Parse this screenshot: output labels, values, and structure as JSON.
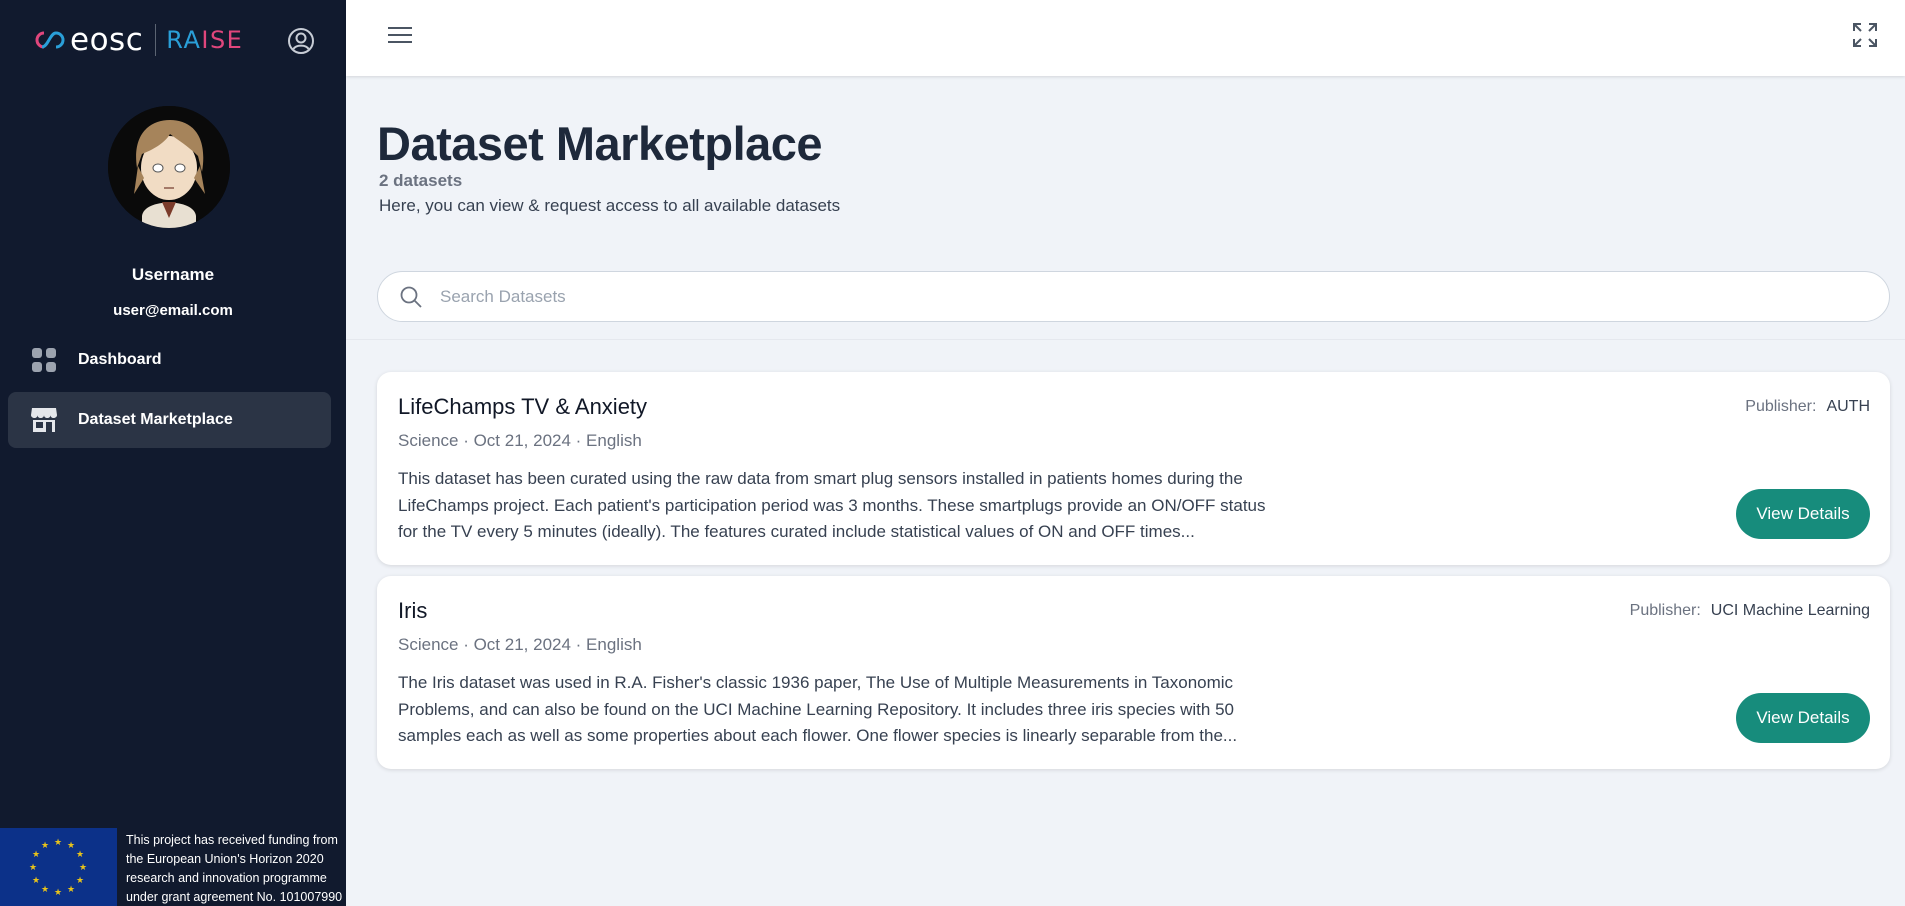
{
  "brand": {
    "name": "eosc",
    "product_a": "RA",
    "product_b": "ISE"
  },
  "user": {
    "username": "Username",
    "email": "user@email.com"
  },
  "sidebar": {
    "items": [
      {
        "label": "Dashboard",
        "icon": "grid-icon",
        "active": false
      },
      {
        "label": "Dataset Marketplace",
        "icon": "store-icon",
        "active": true
      }
    ]
  },
  "funding": {
    "text": "This project has received funding from the European Union's Horizon 2020 research and innovation programme under grant agreement No. 101007990"
  },
  "page": {
    "title": "Dataset Marketplace",
    "count": "2 datasets",
    "subtitle": "Here, you can view & request access to all available datasets"
  },
  "search": {
    "placeholder": "Search Datasets",
    "value": ""
  },
  "datasets": [
    {
      "title": "LifeChamps TV & Anxiety",
      "meta": "Science · Oct 21, 2024 · English",
      "description": "This dataset has been curated using the raw data from smart plug sensors installed in patients homes during the LifeChamps project. Each patient's participation period was 3 months. These smartplugs provide an ON/OFF status for the TV every 5 minutes (ideally). The features curated include statistical values of ON and OFF times...",
      "publisher_label": "Publisher:",
      "publisher": "AUTH",
      "button": "View Details"
    },
    {
      "title": "Iris",
      "meta": "Science · Oct 21, 2024 · English",
      "description": "The Iris dataset was used in R.A. Fisher's classic 1936 paper, The Use of Multiple Measurements in Taxonomic Problems, and can also be found on the UCI Machine Learning Repository. It includes three iris species with 50 samples each as well as some properties about each flower. One flower species is linearly separable from the...",
      "publisher_label": "Publisher:",
      "publisher": "UCI Machine Learning",
      "button": "View Details"
    }
  ],
  "colors": {
    "sidebar": "#111a2e",
    "accent": "#178c7c",
    "raise_blue": "#2a9fd8",
    "raise_pink": "#e0467c"
  }
}
